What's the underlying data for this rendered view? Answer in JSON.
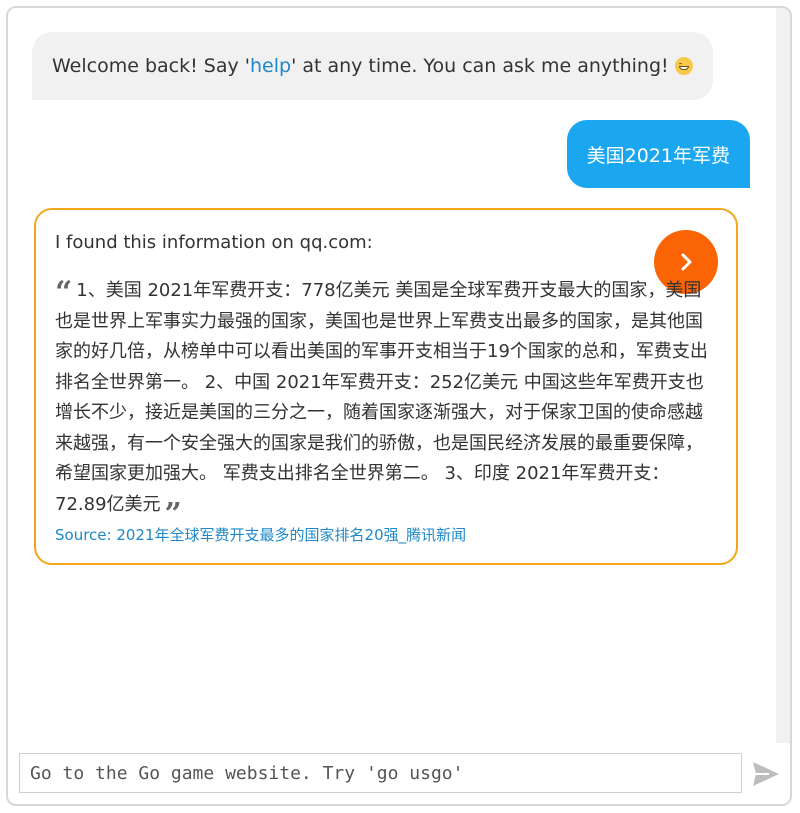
{
  "welcome": {
    "text_before": "Welcome back! Say '",
    "help_keyword": "help",
    "text_after": "' at any time. You can ask me anything!",
    "emoji": "grinning-face-icon"
  },
  "user_message": {
    "text": "美国2021年军费"
  },
  "answer": {
    "intro": "I found this information on qq.com:",
    "quote_open": "“",
    "quote_text": "1、美国 2021年军费开支：778亿美元 美国是全球军费开支最大的国家，美国也是世界上军事实力最强的国家，美国也是世界上军费支出最多的国家，是其他国家的好几倍，从榜单中可以看出美国的军事开支相当于19个国家的总和，军费支出排名全世界第一。 2、中国 2021年军费开支：252亿美元 中国这些年军费开支也增长不少，接近是美国的三分之一，随着国家逐渐强大，对于保家卫国的使命感越来越强，有一个安全强大的国家是我们的骄傲，也是国民经济发展的最重要保障，希望国家更加强大。 军费支出排名全世界第二。 3、印度 2021年军费开支：72.89亿美元",
    "quote_close": "”",
    "source_prefix": "Source: ",
    "source_link_text": "2021年全球军费开支最多的国家排名20强_腾讯新闻",
    "next_icon": "chevron-right-icon"
  },
  "input": {
    "placeholder": "Go to the Go game website. Try 'go usgo'",
    "value": ""
  },
  "send": {
    "icon": "paper-plane-icon"
  },
  "colors": {
    "user_bubble": "#1aa7ef",
    "card_border": "#f3a51c",
    "next_button": "#fa6405",
    "link": "#1e88c8",
    "bot_bubble": "#f1f1f1"
  }
}
